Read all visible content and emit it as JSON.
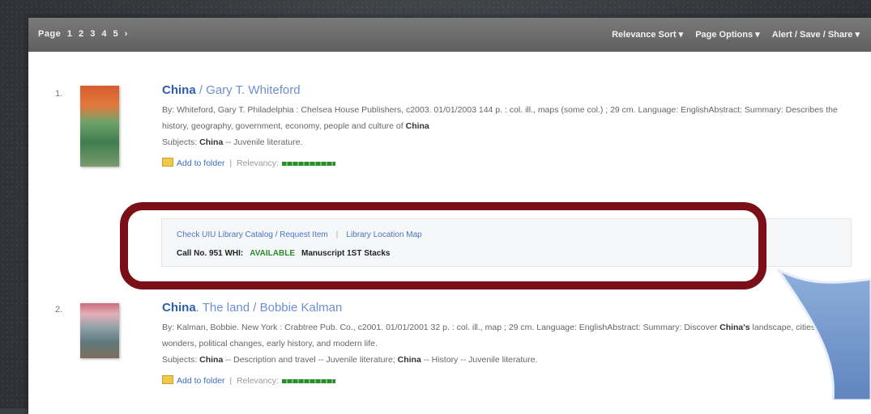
{
  "topbar": {
    "pager_label": "Page",
    "pages": [
      "1",
      "2",
      "3",
      "4",
      "5",
      "›"
    ],
    "sort_label": "Relevance Sort ▾",
    "page_options_label": "Page Options ▾",
    "share_label": "Alert / Save / Share ▾"
  },
  "results": [
    {
      "number": "1.",
      "title": "China",
      "author": " / Gary T. Whiteford",
      "details": "By: Whiteford, Gary T.  Philadelphia : Chelsea House Publishers, c2003. 01/01/2003 144 p. : col. ill., maps (some col.) ; 29 cm. Language: EnglishAbstract: Summary: Describes the history, geography, government, economy, people and culture of",
      "details_end": "China",
      "subjects_label": "Subjects:",
      "subjects_value": "China",
      "subjects_rest": " -- Juvenile literature.",
      "add_folder": "Add to folder",
      "relevancy_label": "Relevancy:"
    },
    {
      "number": "2.",
      "title": "China",
      "author": ". The land / Bobbie Kalman",
      "details_start": "By: Kalman, Bobbie.  New York : Crabtree Pub. Co., c2001. 01/01/2001 32 p. : col. ill., map ; 29 cm. Language: EnglishAbstract: Summary: Discover",
      "details_bold": "China's",
      "details_end": " landscape, cities, wonders, political changes, early history, and modern life.",
      "subjects_label": "Subjects:",
      "subjects_value": "China",
      "subjects_mid": " -- Description and travel -- Juvenile literature;",
      "subjects_value2": "China",
      "subjects_rest": " -- History -- Juvenile literature.",
      "add_folder": "Add to folder",
      "relevancy_label": "Relevancy:"
    }
  ],
  "holdings": {
    "catalog_link": "Check UIU Library Catalog / Request Item",
    "map_link": "Library Location Map",
    "call_no": "Call No. 951 WHI:",
    "status": "AVAILABLE",
    "location": "Manuscript 1ST Stacks"
  },
  "colors": {
    "highlight": "#7a0f17",
    "link": "#3a6fc2",
    "available": "#2e8b2e",
    "callout": "#6f92c8"
  }
}
